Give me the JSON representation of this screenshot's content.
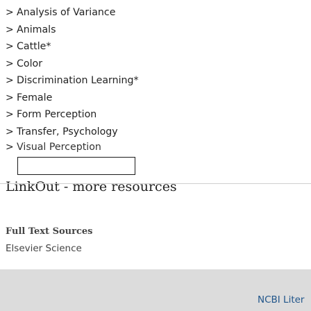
{
  "mesh_terms": [
    {
      "label": "Analysis of Variance"
    },
    {
      "label": "Animals"
    },
    {
      "label": "Cattle*"
    },
    {
      "label": "Color"
    },
    {
      "label": "Discrimination Learning*"
    },
    {
      "label": "Female"
    },
    {
      "label": "Form Perception"
    },
    {
      "label": "Transfer, Psychology"
    },
    {
      "label": "Visual Perception"
    }
  ],
  "chevron_glyph": ">",
  "linkout": {
    "heading": "LinkOut - more resources",
    "full_text_heading": "Full Text Sources",
    "sources": [
      "Elsevier Science"
    ]
  },
  "footer": {
    "link_label": "NCBI Liter"
  }
}
